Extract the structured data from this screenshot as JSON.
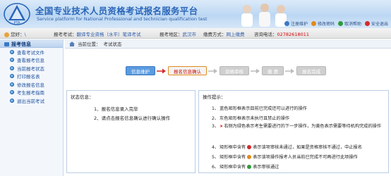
{
  "header": {
    "title_cn": "全国专业技术人员资格考试报名服务平台",
    "title_en": "Service platform for National Professional and technician qualification test",
    "logo_text": "PTA",
    "links": [
      {
        "label": "注册维护",
        "color": "#3a78c8"
      },
      {
        "label": "修改密码",
        "color": "#e08a1c"
      },
      {
        "label": "取消帮助",
        "color": "#2e9b3a"
      },
      {
        "label": "安全退出",
        "color": "#d42a2a"
      }
    ]
  },
  "infobar": {
    "welcome_label": "您好：",
    "welcome_value": "\\",
    "exam_label": "报考考试：",
    "exam_value": "翻译专业资格（水平）笔译考试",
    "region_label": "报考地区：",
    "region_value": "武汉市",
    "fee_label": "缴费方式：",
    "fee_value": "网上缴费",
    "phone_label": "咨询电话：",
    "phone_value": "02782618011"
  },
  "sidebar": {
    "title": "报考信息",
    "items": [
      {
        "label": "查看考试文件"
      },
      {
        "label": "查看报考信息"
      },
      {
        "label": "当前报考状态"
      },
      {
        "label": "打印报名表"
      },
      {
        "label": "修改报名信息"
      },
      {
        "label": "考生报考指南"
      },
      {
        "label": "退出当前考试"
      }
    ]
  },
  "breadcrumb": {
    "label": "当前位置：",
    "value": "考试状态"
  },
  "steps": [
    {
      "label": "信息维护",
      "state": "done"
    },
    {
      "label": "报名信息确认",
      "state": "current"
    },
    {
      "label": "资格审核",
      "state": "todo"
    },
    {
      "label": "缴 费",
      "state": "todo"
    },
    {
      "label": "报名完成",
      "state": "todo"
    }
  ],
  "status_panel": {
    "title": "状态信息：",
    "lines": [
      "1、报名信息录入完毕",
      "2、请点击报名信息确认进行确认操作"
    ]
  },
  "tips_panel": {
    "title": "操作提示：",
    "lines": [
      {
        "num": "1、",
        "text": "蓝色矩形框表示目前已完成还可以进行的操作"
      },
      {
        "num": "2、",
        "text": "灰色矩形框表示未执行且禁止的操作"
      },
      {
        "num": "3、",
        "pre": "",
        "post": "右侧为绿色表示考生需要进行的下一步操作，为黄色表示需要等待机构完成的操作"
      },
      {
        "num": "4、",
        "pre": "矩形框中含有",
        "post": "表示该项审核未通过，如果是资格审核不通过，中止报名"
      },
      {
        "num": "5、",
        "pre": "矩形框中含有",
        "post": "表示该项审核尚未完成或资格审核中，请耐心等待"
      },
      {
        "num": "6、",
        "pre": "矩形框中含有",
        "post": "表示审核通过"
      }
    ],
    "line5_display": "矩形框中含有",
    "line5_post": "表示该项操作报考人员当前已完成不可再进行此项操作"
  },
  "colors": {
    "blue_step": "#5b9be0",
    "current_text": "#cc1100",
    "link": "#2e5fae",
    "phone": "#d40000"
  }
}
